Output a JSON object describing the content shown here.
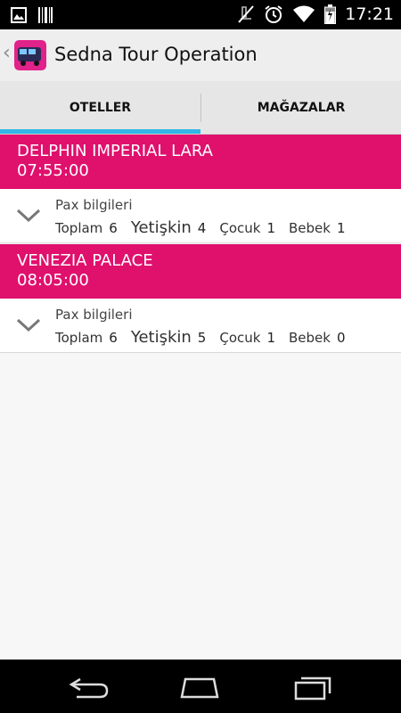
{
  "status_bar": {
    "time": "17:21",
    "icons": [
      "image-icon",
      "barcode-icon",
      "mute-icon",
      "alarm-icon",
      "wifi-icon",
      "battery-icon"
    ]
  },
  "action_bar": {
    "title": "Sedna Tour Operation",
    "logo": "bus-logo-icon"
  },
  "tabs": [
    {
      "label": "OTELLER",
      "selected": true
    },
    {
      "label": "MAĞAZALAR",
      "selected": false
    }
  ],
  "accent_color": "#e0106d",
  "tab_indicator_color": "#33b5e5",
  "hotels": [
    {
      "name": "DELPHIN IMPERIAL LARA",
      "time": "07:55:00",
      "pax_title": "Pax bilgileri",
      "toplam_label": "Toplam",
      "toplam": "6",
      "yetiskin_label": "Yetişkin",
      "yetiskin": "4",
      "cocuk_label": "Çocuk",
      "cocuk": "1",
      "bebek_label": "Bebek",
      "bebek": "1"
    },
    {
      "name": "VENEZIA PALACE",
      "time": "08:05:00",
      "pax_title": "Pax bilgileri",
      "toplam_label": "Toplam",
      "toplam": "6",
      "yetiskin_label": "Yetişkin",
      "yetiskin": "5",
      "cocuk_label": "Çocuk",
      "cocuk": "1",
      "bebek_label": "Bebek",
      "bebek": "0"
    }
  ],
  "nav_bar": {
    "buttons": [
      "back-icon",
      "home-icon",
      "recent-apps-icon"
    ]
  }
}
